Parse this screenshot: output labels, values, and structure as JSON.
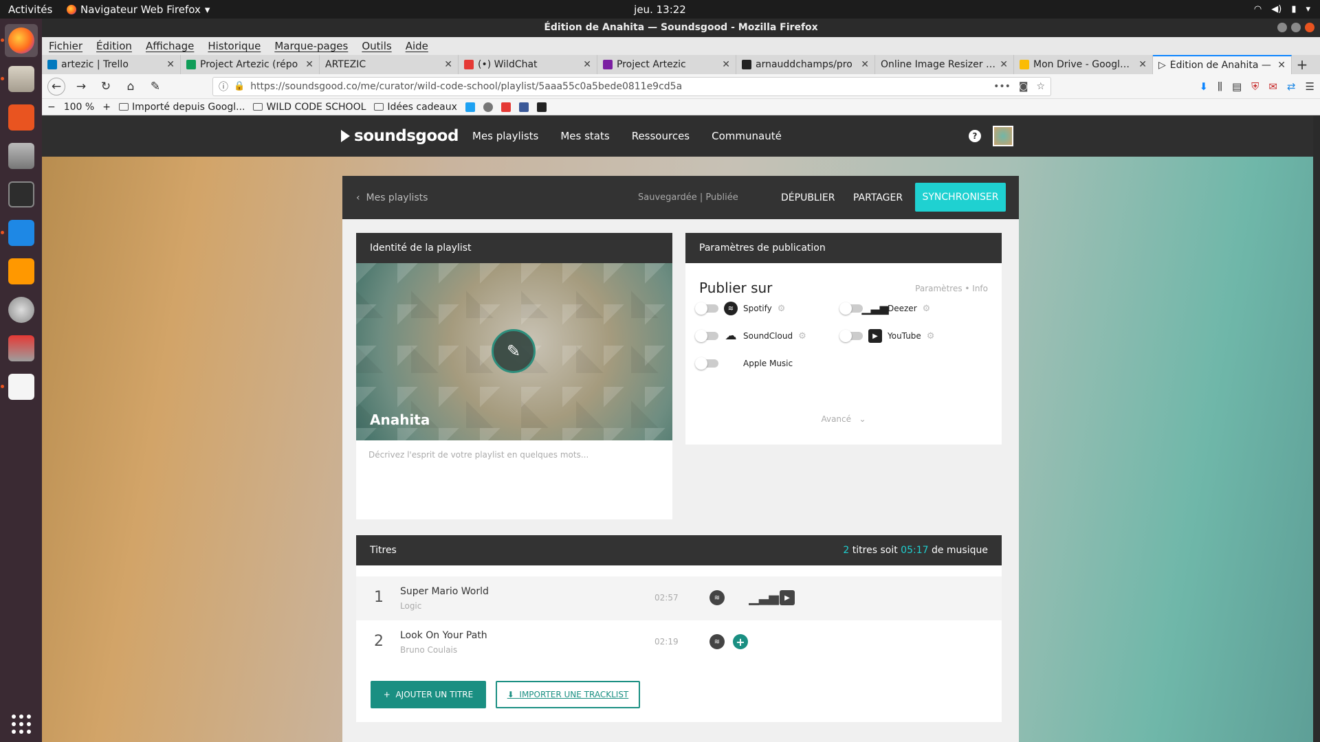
{
  "os": {
    "activities": "Activités",
    "app_menu": "Navigateur Web Firefox",
    "clock": "jeu. 13:22"
  },
  "window": {
    "title": "Édition de Anahita — Soundsgood - Mozilla Firefox"
  },
  "menu": [
    "Fichier",
    "Édition",
    "Affichage",
    "Historique",
    "Marque-pages",
    "Outils",
    "Aide"
  ],
  "tabs": [
    {
      "title": "artezic | Trello",
      "color": "#0079bf"
    },
    {
      "title": "Project Artezic (répo",
      "color": "#0f9d58"
    },
    {
      "title": "ARTEZIC",
      "color": "#d9d9d9"
    },
    {
      "title": "(•) WildChat",
      "color": "#e53935"
    },
    {
      "title": "Project Artezic",
      "color": "#7b1fa2"
    },
    {
      "title": "arnauddchamps/pro",
      "color": "#222222"
    },
    {
      "title": "Online Image Resizer - C",
      "color": "#d9d9d9"
    },
    {
      "title": "Mon Drive - Google D",
      "color": "#fbbc04"
    },
    {
      "title": "Édition de Anahita —",
      "color": "#333333"
    }
  ],
  "nav": {
    "url": "https://soundsgood.co/me/curator/wild-code-school/playlist/5aaa55c0a5bede0811e9cd5a",
    "zoom": "100 %"
  },
  "bookmarks": [
    "Importé depuis Googl...",
    "WILD CODE SCHOOL",
    "Idées cadeaux"
  ],
  "site": {
    "logo": "soundsgood",
    "nav": [
      "Mes playlists",
      "Mes stats",
      "Ressources",
      "Communauté"
    ],
    "help": "?"
  },
  "editor": {
    "back_label": "Mes playlists",
    "status": "Sauvegardée | Publiée",
    "unpublish": "DÉPUBLIER",
    "share": "PARTAGER",
    "sync": "SYNCHRONISER"
  },
  "identity": {
    "heading": "Identité de la playlist",
    "name": "Anahita",
    "description_placeholder": "Décrivez l'esprit de votre playlist en quelques mots..."
  },
  "publish": {
    "heading": "Paramètres de publication",
    "title": "Publier sur",
    "links": "Paramètres • Info",
    "services": [
      "Spotify",
      "Deezer",
      "SoundCloud",
      "YouTube",
      "Apple Music"
    ],
    "advanced": "Avancé"
  },
  "tracklist": {
    "heading": "Titres",
    "count": "2",
    "count_label": "titres soit",
    "duration": "05:17",
    "duration_label": "de musique",
    "tracks": [
      {
        "num": "1",
        "title": "Super Mario World",
        "artist": "Logic",
        "duration": "02:57"
      },
      {
        "num": "2",
        "title": "Look On Your Path",
        "artist": "Bruno Coulais",
        "duration": "02:19"
      }
    ],
    "add_button": "AJOUTER UN TITRE",
    "import_button": "IMPORTER UNE TRACKLIST"
  }
}
